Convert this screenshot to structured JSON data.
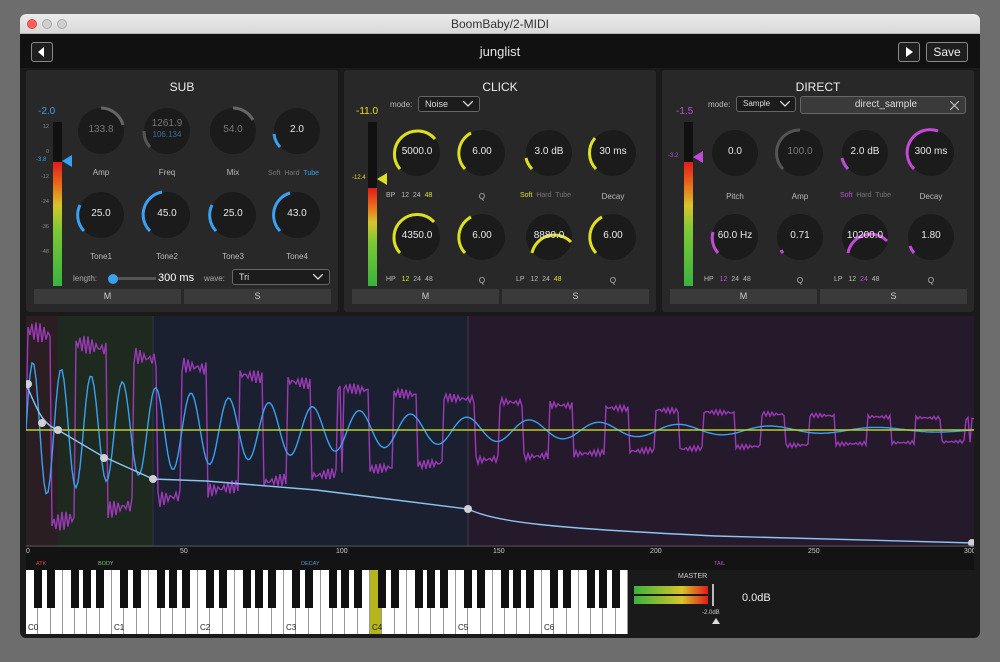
{
  "window": {
    "title": "BoomBaby/2-MIDI"
  },
  "header": {
    "preset": "junglist",
    "save_label": "Save"
  },
  "sub": {
    "title": "SUB",
    "meter_level": "-2.0",
    "meter_marker": "-3.8",
    "scale": [
      "12",
      "0",
      "-12",
      "-24",
      "-36",
      "-48"
    ],
    "knobs": [
      {
        "value": "133.8",
        "label": "Amp",
        "dim": true
      },
      {
        "value": "1261.9",
        "label": "Freq",
        "dim": true,
        "sub": "106.134"
      },
      {
        "value": "54.0",
        "label": "Mix",
        "dim": true
      },
      {
        "value": "2.0",
        "label": "",
        "dim": false
      }
    ],
    "sat": [
      "Soft",
      "Hard",
      "Tube"
    ],
    "tones": [
      {
        "value": "25.0",
        "label": "Tone1"
      },
      {
        "value": "45.0",
        "label": "Tone2"
      },
      {
        "value": "25.0",
        "label": "Tone3"
      },
      {
        "value": "43.0",
        "label": "Tone4"
      }
    ],
    "length_label": "length:",
    "length_value": "300 ms",
    "wave_label": "wave:",
    "wave_value": "Tri",
    "m": "M",
    "s": "S"
  },
  "click": {
    "title": "CLICK",
    "meter_level": "-11.0",
    "meter_marker": "-12.4",
    "mode_label": "mode:",
    "mode_value": "Noise",
    "row1": [
      {
        "value": "5000.0"
      },
      {
        "value": "6.00",
        "label": "Q"
      },
      {
        "value": "3.0 dB"
      },
      {
        "value": "30 ms",
        "label": "Decay"
      }
    ],
    "bp": {
      "label": "BP",
      "opts": [
        "12",
        "24",
        "48"
      ]
    },
    "sat": [
      "Soft",
      "Hard",
      "Tube"
    ],
    "row2": [
      {
        "value": "4350.0"
      },
      {
        "value": "6.00",
        "label": "Q"
      },
      {
        "value": "8880.0"
      },
      {
        "value": "6.00",
        "label": "Q"
      }
    ],
    "hp": {
      "label": "HP",
      "opts": [
        "12",
        "24",
        "48"
      ]
    },
    "lp": {
      "label": "LP",
      "opts": [
        "12",
        "24",
        "48"
      ]
    },
    "m": "M",
    "s": "S"
  },
  "direct": {
    "title": "DIRECT",
    "meter_level": "-1.5",
    "meter_marker": "-3.2",
    "mode_label": "mode:",
    "mode_value": "Sample",
    "sample": "direct_sample",
    "row1": [
      {
        "value": "0.0",
        "label": "Pitch"
      },
      {
        "value": "100.0",
        "label": "Amp",
        "dim": true
      },
      {
        "value": "2.0 dB",
        "label": ""
      },
      {
        "value": "300 ms",
        "label": "Decay"
      }
    ],
    "sat": [
      "Soft",
      "Hard",
      "Tube"
    ],
    "row2": [
      {
        "value": "60.0 Hz"
      },
      {
        "value": "0.71",
        "label": "Q"
      },
      {
        "value": "10200.0"
      },
      {
        "value": "1.80",
        "label": "Q"
      }
    ],
    "hp": {
      "label": "HP",
      "opts": [
        "12",
        "24",
        "48"
      ]
    },
    "lp": {
      "label": "LP",
      "opts": [
        "12",
        "24",
        "48"
      ]
    },
    "m": "M",
    "s": "S"
  },
  "timeline": {
    "ticks": [
      "0",
      "50",
      "100",
      "150",
      "200",
      "250",
      "300"
    ],
    "regions": [
      "ATK",
      "BODY",
      "DECAY",
      "TAIL"
    ]
  },
  "keyboard": {
    "labels": [
      "C0",
      "C1",
      "C2",
      "C3",
      "C4",
      "C5",
      "C6"
    ]
  },
  "master": {
    "label": "MASTER",
    "gain": "0.0dB",
    "level": "-2.0dB"
  },
  "colors": {
    "sub": "#3aa0f0",
    "click": "#dde021",
    "direct": "#c34ad8"
  }
}
